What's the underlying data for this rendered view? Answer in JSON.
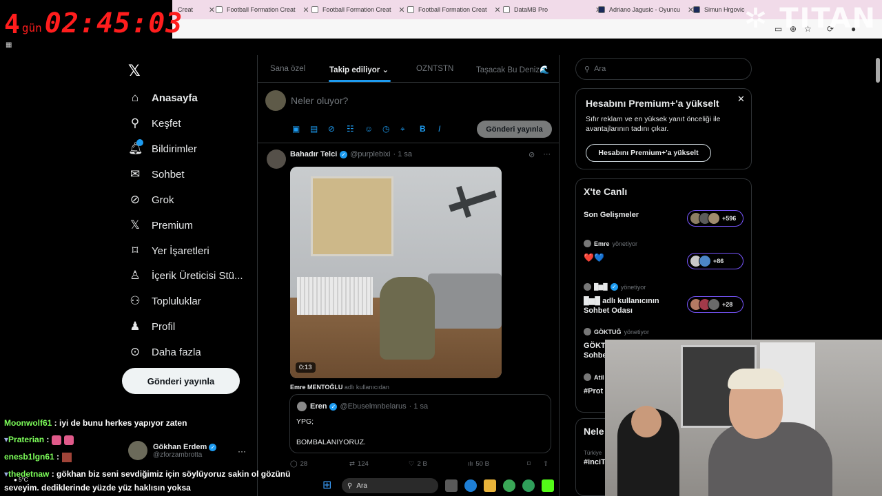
{
  "overlay": {
    "timer_days": "4",
    "timer_unit": "gün",
    "timer_clock": "02:45:03",
    "brand": "TITAN"
  },
  "browser": {
    "tabs": [
      {
        "label": "Football Formation Creat"
      },
      {
        "label": "Football Formation Creat"
      },
      {
        "label": "Football Formation Creat"
      },
      {
        "label": "Football Formation Creat"
      },
      {
        "label": "DataMB Pro"
      },
      {
        "label": "Adriano Jagusic - Oyuncu"
      },
      {
        "label": "Simun Hrgovic"
      }
    ],
    "first_tab_fragment": "Creat"
  },
  "nav": {
    "items": [
      {
        "label": "Anasayfa",
        "icon": "home-icon"
      },
      {
        "label": "Keşfet",
        "icon": "search-icon"
      },
      {
        "label": "Bildirimler",
        "icon": "bell-icon"
      },
      {
        "label": "Sohbet",
        "icon": "mail-icon"
      },
      {
        "label": "Grok",
        "icon": "grok-icon"
      },
      {
        "label": "Premium",
        "icon": "x-icon"
      },
      {
        "label": "Yer İşaretleri",
        "icon": "bookmark-icon"
      },
      {
        "label": "İçerik Üreticisi Stü...",
        "icon": "creator-icon"
      },
      {
        "label": "Topluluklar",
        "icon": "communities-icon"
      },
      {
        "label": "Profil",
        "icon": "profile-icon"
      },
      {
        "label": "Daha fazla",
        "icon": "more-icon"
      }
    ],
    "notif_badge": "",
    "post_button": "Gönderi yayınla",
    "account": {
      "name": "Gökhan Erdem",
      "handle": "@zforzambrotta"
    }
  },
  "feed": {
    "tabs": [
      "Sana özel",
      "Takip ediliyor",
      "OZNTSTN",
      "Taşacak Bu Deniz🌊"
    ],
    "composer_placeholder": "Neler oluyor?",
    "composer_post": "Gönderi yayınla",
    "tweet": {
      "name": "Bahadır Telci",
      "handle": "@purplebixi",
      "time": "· 1 sa",
      "video_time": "0:13",
      "reposter": "Emre MENTOĞLU",
      "reposter_suffix": "adlı kullanıcıdan",
      "quote": {
        "name": "Eren",
        "handle": "@Ebuselmnbelarus",
        "time": "· 1 sa",
        "line1": "YPG;",
        "line2": "BOMBALANIYORUZ."
      },
      "actions": {
        "replies": "28",
        "reposts": "124",
        "likes": "2 B",
        "views": "50 B"
      }
    }
  },
  "right": {
    "search_placeholder": "Ara",
    "premium": {
      "title": "Hesabını Premium+'a yükselt",
      "desc": "Sıfır reklam ve en yüksek yanıt önceliği ile avantajlarının tadını çıkar.",
      "button": "Hesabını Premium+'a yükselt"
    },
    "live": {
      "title": "X'te Canlı",
      "items": [
        {
          "title": "Son Gelişmeler",
          "count": "+596"
        },
        {
          "host": "Emre",
          "role": "yönetiyor",
          "title": "❤️💙",
          "count": "+86"
        },
        {
          "host": "█▆█",
          "role": "yönetiyor",
          "title": "█▆█ adlı kullanıcının Sohbet Odası",
          "count": "+28"
        },
        {
          "host": "GÖKTUĞ",
          "role": "yönetiyor",
          "title": "GÖKT Sohbe"
        },
        {
          "host": "Atil",
          "title": "#Prot"
        }
      ]
    },
    "next": {
      "title": "Nele",
      "sub": "Türkiye",
      "tag": "#inciT"
    }
  },
  "chat": [
    {
      "user": "Moonwolf61",
      "text": ": iyi de bunu herkes yapıyor zaten"
    },
    {
      "user": "Praterian",
      "text": ":"
    },
    {
      "user": "enesb1lgn61",
      "text": ":"
    },
    {
      "user": "thedetnaw",
      "text": ": gökhan biz seni sevdiğimiz için söylüyoruz sakin ol gözünü"
    },
    {
      "user": "",
      "text": "seveyim. dediklerinde yüzde yüz haklısın yoksa"
    }
  ],
  "taskbar": {
    "search": "Ara",
    "weather": "5°C"
  }
}
